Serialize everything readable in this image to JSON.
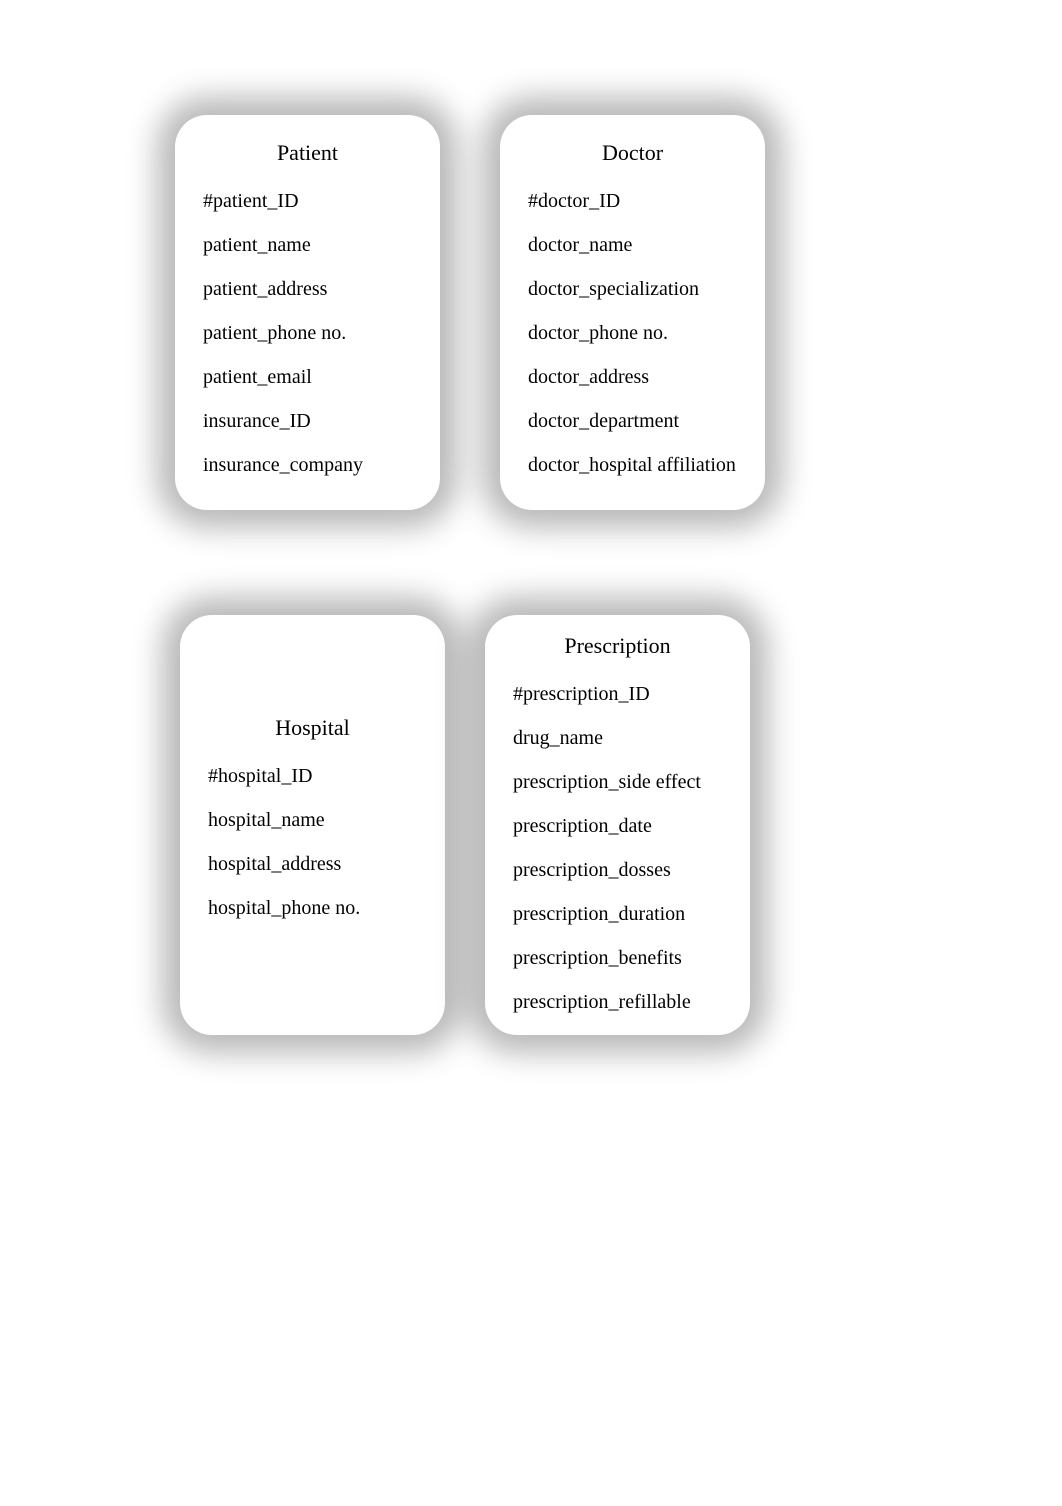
{
  "entities": {
    "patient": {
      "title": "Patient",
      "attributes": [
        "#patient_ID",
        "patient_name",
        "patient_address",
        "patient_phone no.",
        "patient_email",
        "insurance_ID",
        "insurance_company"
      ]
    },
    "doctor": {
      "title": "Doctor",
      "attributes": [
        "#doctor_ID",
        "doctor_name",
        "doctor_specialization",
        "doctor_phone no.",
        "doctor_address",
        "doctor_department",
        "doctor_hospital affiliation"
      ]
    },
    "hospital": {
      "title": "Hospital",
      "attributes": [
        "#hospital_ID",
        "hospital_name",
        "hospital_address",
        "hospital_phone no."
      ]
    },
    "prescription": {
      "title": "Prescription",
      "attributes": [
        "#prescription_ID",
        "drug_name",
        "prescription_side effect",
        "prescription_date",
        "prescription_dosses",
        "prescription_duration",
        "prescription_benefits",
        "prescription_refillable"
      ]
    }
  }
}
